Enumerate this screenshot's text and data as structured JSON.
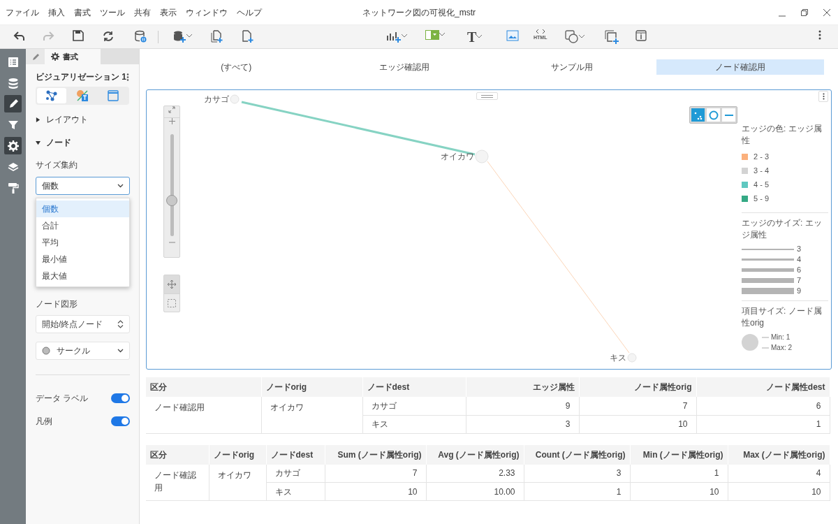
{
  "menu": [
    "ファイル",
    "挿入",
    "書式",
    "ツール",
    "共有",
    "表示",
    "ウィンドウ",
    "ヘルプ"
  ],
  "window": {
    "title": "ネットワーク図の可視化_mstr"
  },
  "toolbar": {
    "text_tool_glyph": "T",
    "html_label": "HTML"
  },
  "rail": [
    {
      "kind": "list",
      "selected": false
    },
    {
      "kind": "data",
      "selected": false
    },
    {
      "kind": "edit",
      "selected": true
    },
    {
      "kind": "filter",
      "selected": false
    },
    {
      "kind": "gear",
      "selected": true
    },
    {
      "kind": "layers",
      "selected": false
    },
    {
      "kind": "roller",
      "selected": false
    }
  ],
  "panel": {
    "tabs": [
      {
        "kind": "pencil",
        "selected": false
      },
      {
        "kind": "gear",
        "label": "書式",
        "selected": true
      }
    ],
    "title": "ビジュアリゼーション 1",
    "modes": [
      {
        "kind": "network",
        "selected": true
      },
      {
        "kind": "text",
        "selected": false
      },
      {
        "kind": "frame",
        "selected": false
      }
    ],
    "sections": [
      {
        "label": "レイアウト",
        "expanded": false
      },
      {
        "label": "ノード",
        "expanded": true
      }
    ],
    "size_label": "サイズ集約",
    "size_select": {
      "value": "個数",
      "options": [
        {
          "label": "個数",
          "selected": true
        },
        {
          "label": "合計",
          "selected": false
        },
        {
          "label": "平均",
          "selected": false
        },
        {
          "label": "最小値",
          "selected": false
        },
        {
          "label": "最大値",
          "selected": false
        }
      ]
    },
    "shape_label": "ノード図形",
    "shape_select": "開始/終点ノード",
    "circle_select": "サークル",
    "toggles": [
      {
        "label": "データ ラベル",
        "on": true
      },
      {
        "label": "凡例",
        "on": true
      }
    ]
  },
  "tabs": [
    {
      "label": "(すべて)",
      "selected": false
    },
    {
      "label": "エッジ確認用",
      "selected": false
    },
    {
      "label": "サンプル用",
      "selected": false
    },
    {
      "label": "ノード確認用",
      "selected": true
    }
  ],
  "graph": {
    "nodes": [
      "カサゴ",
      "オイカワ",
      "キス"
    ],
    "edges": [
      {
        "kind": "thick",
        "color": "#86d3c3"
      },
      {
        "kind": "thin",
        "color": "#fbd5b8"
      }
    ],
    "zoom": {
      "level": 0.35
    },
    "legend_modes": [
      {
        "kind": "dots",
        "selected": true
      },
      {
        "kind": "circle",
        "selected": false
      },
      {
        "kind": "line",
        "selected": false
      }
    ],
    "legend": {
      "color_title": "エッジの色: エッジ属性",
      "color_items": [
        {
          "label": "2 - 3",
          "color": "#fbb07c"
        },
        {
          "label": "3 - 4",
          "color": "#d3d3d3"
        },
        {
          "label": "4 - 5",
          "color": "#5fc8c0"
        },
        {
          "label": "5 - 9",
          "color": "#35a985"
        }
      ],
      "size_title": "エッジのサイズ: エッジ属性",
      "size_items": [
        "3",
        "4",
        "6",
        "7",
        "9"
      ],
      "item_title": "項目サイズ: ノード属性orig",
      "min": "Min: 1",
      "max": "Max: 2"
    }
  },
  "table1": {
    "columns": [
      "区分",
      "ノードorig",
      "ノードdest",
      "エッジ属性",
      "ノード属性orig",
      "ノード属性dest"
    ],
    "groups": [
      {
        "group": "ノード確認用",
        "orig": "オイカワ",
        "rows": [
          [
            "カサゴ",
            "9",
            "7",
            "6"
          ],
          [
            "キス",
            "3",
            "10",
            "1"
          ]
        ]
      }
    ]
  },
  "table2": {
    "columns": [
      "区分",
      "ノードorig",
      "ノードdest",
      "Sum (ノード属性orig)",
      "Avg (ノード属性orig)",
      "Count (ノード属性orig)",
      "Min (ノード属性orig)",
      "Max (ノード属性orig)"
    ],
    "groups": [
      {
        "group": "ノード確認用",
        "orig": "オイカワ",
        "rows": [
          [
            "カサゴ",
            "7",
            "2.33",
            "3",
            "1",
            "4"
          ],
          [
            "キス",
            "10",
            "10.00",
            "1",
            "10",
            "10"
          ]
        ]
      }
    ]
  }
}
